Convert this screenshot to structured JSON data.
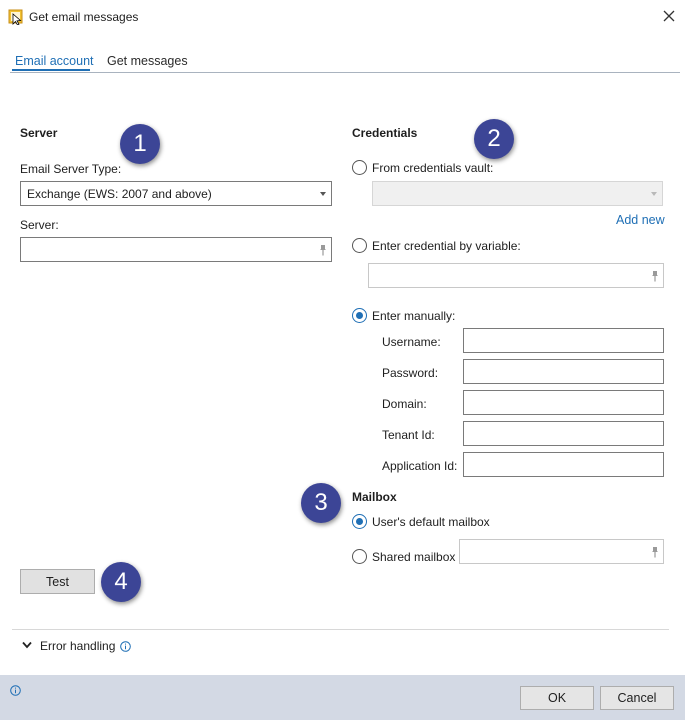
{
  "window": {
    "title": "Get email messages",
    "close_icon": "close-icon",
    "app_icon": "email-action-icon"
  },
  "tabs": [
    {
      "label": "Email account",
      "active": true
    },
    {
      "label": "Get messages",
      "active": false
    }
  ],
  "server": {
    "section_title": "Server",
    "badge": "1",
    "type_label": "Email Server Type:",
    "type_value": "Exchange (EWS: 2007 and above)",
    "server_label": "Server:",
    "server_value": ""
  },
  "credentials": {
    "section_title": "Credentials",
    "badge": "2",
    "options": {
      "vault": {
        "label": "From credentials vault:",
        "selected": false,
        "value": ""
      },
      "variable": {
        "label": "Enter credential by variable:",
        "selected": false,
        "value": ""
      },
      "manual": {
        "label": "Enter manually:",
        "selected": true
      }
    },
    "add_new_label": "Add new",
    "fields": {
      "username": {
        "label": "Username:",
        "value": ""
      },
      "password": {
        "label": "Password:",
        "value": ""
      },
      "domain": {
        "label": "Domain:",
        "value": ""
      },
      "tenant_id": {
        "label": "Tenant Id:",
        "value": ""
      },
      "application_id": {
        "label": "Application Id:",
        "value": ""
      }
    }
  },
  "mailbox": {
    "section_title": "Mailbox",
    "badge": "3",
    "options": {
      "default": {
        "label": "User's default mailbox",
        "selected": true
      },
      "shared": {
        "label": "Shared mailbox",
        "selected": false,
        "value": ""
      }
    }
  },
  "test": {
    "button_label": "Test",
    "badge": "4"
  },
  "error_handling": {
    "label": "Error handling",
    "expanded": false
  },
  "footer": {
    "ok_label": "OK",
    "cancel_label": "Cancel"
  },
  "colors": {
    "accent": "#1f6fb5",
    "badge": "#3c4596",
    "footer_bg": "#d3d9e4"
  }
}
